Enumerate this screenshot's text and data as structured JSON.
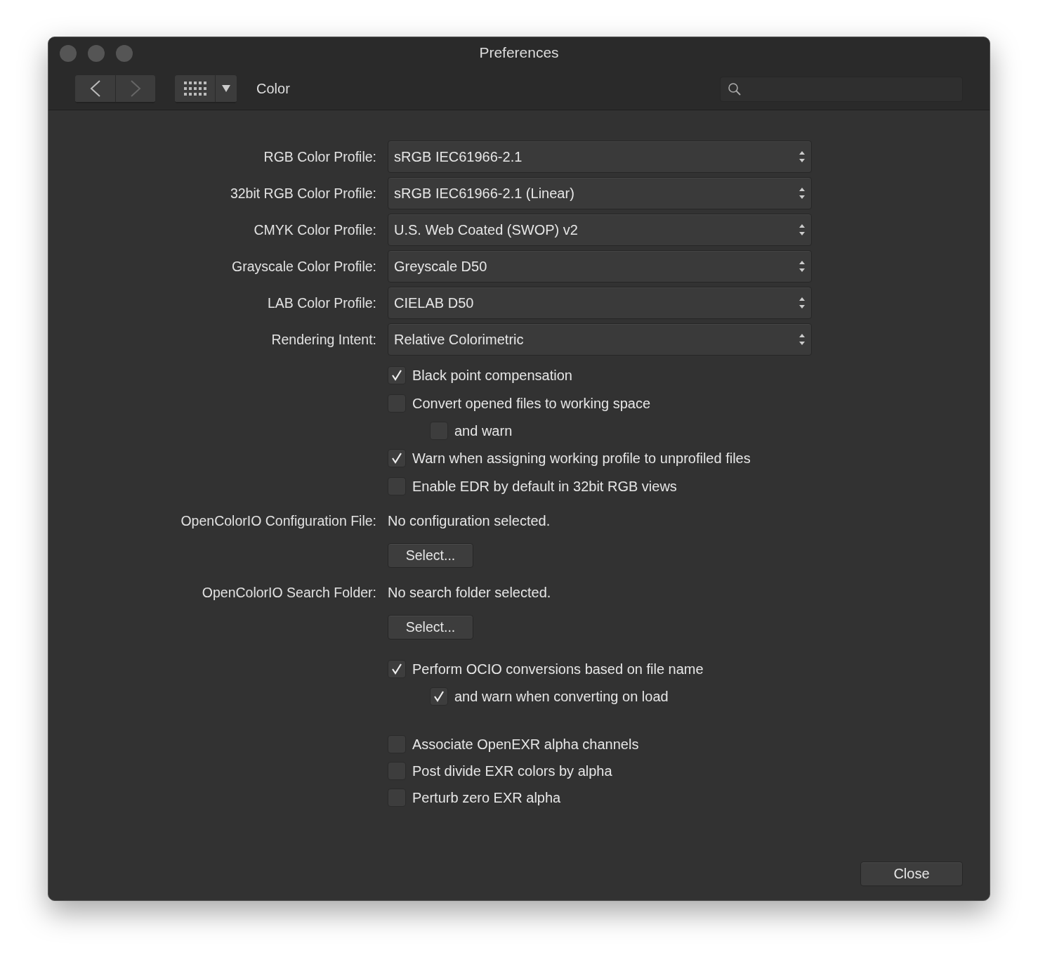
{
  "window": {
    "title": "Preferences"
  },
  "toolbar": {
    "section": "Color"
  },
  "profiles": [
    {
      "label": "RGB Color Profile:",
      "value": "sRGB IEC61966-2.1"
    },
    {
      "label": "32bit RGB Color Profile:",
      "value": "sRGB IEC61966-2.1 (Linear)"
    },
    {
      "label": "CMYK Color Profile:",
      "value": "U.S. Web Coated (SWOP) v2"
    },
    {
      "label": "Grayscale Color Profile:",
      "value": "Greyscale D50"
    },
    {
      "label": "LAB Color Profile:",
      "value": "CIELAB D50"
    },
    {
      "label": "Rendering Intent:",
      "value": "Relative Colorimetric"
    }
  ],
  "options": [
    {
      "label": "Black point compensation",
      "checked": true
    },
    {
      "label": "Convert opened files to working space",
      "checked": false,
      "children": [
        {
          "label": "and warn",
          "checked": false
        }
      ]
    },
    {
      "label": "Warn when assigning working profile to unprofiled files",
      "checked": true
    },
    {
      "label": "Enable EDR by default in 32bit RGB views",
      "checked": false
    }
  ],
  "ocio": [
    {
      "label": "OpenColorIO Configuration File:",
      "value": "No configuration selected.",
      "button": "Select..."
    },
    {
      "label": "OpenColorIO Search Folder:",
      "value": "No search folder selected.",
      "button": "Select..."
    }
  ],
  "ocio_options": [
    {
      "label": "Perform OCIO conversions based on file name",
      "checked": true,
      "children": [
        {
          "label": "and warn when converting on load",
          "checked": true
        }
      ]
    }
  ],
  "exr_options": [
    {
      "label": "Associate OpenEXR alpha channels",
      "checked": false
    },
    {
      "label": "Post divide EXR colors by alpha",
      "checked": false
    },
    {
      "label": "Perturb zero EXR alpha",
      "checked": false
    }
  ],
  "close_button": "Close"
}
